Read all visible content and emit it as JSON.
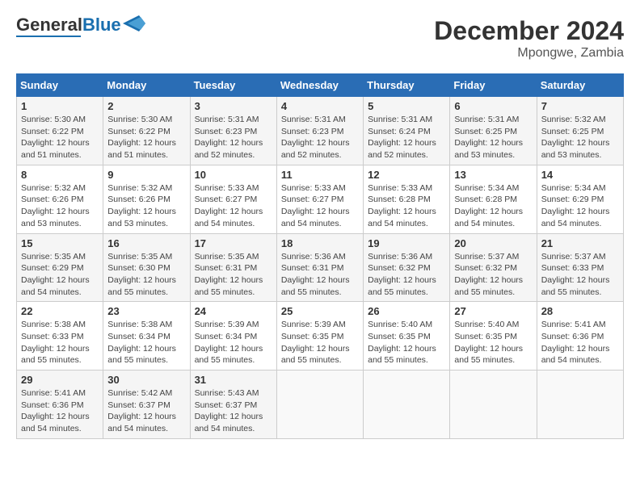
{
  "header": {
    "logo_general": "General",
    "logo_blue": "Blue",
    "title": "December 2024",
    "subtitle": "Mpongwe, Zambia"
  },
  "calendar": {
    "days_of_week": [
      "Sunday",
      "Monday",
      "Tuesday",
      "Wednesday",
      "Thursday",
      "Friday",
      "Saturday"
    ],
    "weeks": [
      [
        {
          "day": "",
          "info": ""
        },
        {
          "day": "2",
          "info": "Sunrise: 5:30 AM\nSunset: 6:22 PM\nDaylight: 12 hours\nand 51 minutes."
        },
        {
          "day": "3",
          "info": "Sunrise: 5:31 AM\nSunset: 6:23 PM\nDaylight: 12 hours\nand 52 minutes."
        },
        {
          "day": "4",
          "info": "Sunrise: 5:31 AM\nSunset: 6:23 PM\nDaylight: 12 hours\nand 52 minutes."
        },
        {
          "day": "5",
          "info": "Sunrise: 5:31 AM\nSunset: 6:24 PM\nDaylight: 12 hours\nand 52 minutes."
        },
        {
          "day": "6",
          "info": "Sunrise: 5:31 AM\nSunset: 6:25 PM\nDaylight: 12 hours\nand 53 minutes."
        },
        {
          "day": "7",
          "info": "Sunrise: 5:32 AM\nSunset: 6:25 PM\nDaylight: 12 hours\nand 53 minutes."
        }
      ],
      [
        {
          "day": "1",
          "info": "Sunrise: 5:30 AM\nSunset: 6:22 PM\nDaylight: 12 hours\nand 51 minutes."
        },
        {
          "day": "",
          "info": ""
        },
        {
          "day": "",
          "info": ""
        },
        {
          "day": "",
          "info": ""
        },
        {
          "day": "",
          "info": ""
        },
        {
          "day": "",
          "info": ""
        },
        {
          "day": "",
          "info": ""
        }
      ],
      [
        {
          "day": "8",
          "info": "Sunrise: 5:32 AM\nSunset: 6:26 PM\nDaylight: 12 hours\nand 53 minutes."
        },
        {
          "day": "9",
          "info": "Sunrise: 5:32 AM\nSunset: 6:26 PM\nDaylight: 12 hours\nand 53 minutes."
        },
        {
          "day": "10",
          "info": "Sunrise: 5:33 AM\nSunset: 6:27 PM\nDaylight: 12 hours\nand 54 minutes."
        },
        {
          "day": "11",
          "info": "Sunrise: 5:33 AM\nSunset: 6:27 PM\nDaylight: 12 hours\nand 54 minutes."
        },
        {
          "day": "12",
          "info": "Sunrise: 5:33 AM\nSunset: 6:28 PM\nDaylight: 12 hours\nand 54 minutes."
        },
        {
          "day": "13",
          "info": "Sunrise: 5:34 AM\nSunset: 6:28 PM\nDaylight: 12 hours\nand 54 minutes."
        },
        {
          "day": "14",
          "info": "Sunrise: 5:34 AM\nSunset: 6:29 PM\nDaylight: 12 hours\nand 54 minutes."
        }
      ],
      [
        {
          "day": "15",
          "info": "Sunrise: 5:35 AM\nSunset: 6:29 PM\nDaylight: 12 hours\nand 54 minutes."
        },
        {
          "day": "16",
          "info": "Sunrise: 5:35 AM\nSunset: 6:30 PM\nDaylight: 12 hours\nand 55 minutes."
        },
        {
          "day": "17",
          "info": "Sunrise: 5:35 AM\nSunset: 6:31 PM\nDaylight: 12 hours\nand 55 minutes."
        },
        {
          "day": "18",
          "info": "Sunrise: 5:36 AM\nSunset: 6:31 PM\nDaylight: 12 hours\nand 55 minutes."
        },
        {
          "day": "19",
          "info": "Sunrise: 5:36 AM\nSunset: 6:32 PM\nDaylight: 12 hours\nand 55 minutes."
        },
        {
          "day": "20",
          "info": "Sunrise: 5:37 AM\nSunset: 6:32 PM\nDaylight: 12 hours\nand 55 minutes."
        },
        {
          "day": "21",
          "info": "Sunrise: 5:37 AM\nSunset: 6:33 PM\nDaylight: 12 hours\nand 55 minutes."
        }
      ],
      [
        {
          "day": "22",
          "info": "Sunrise: 5:38 AM\nSunset: 6:33 PM\nDaylight: 12 hours\nand 55 minutes."
        },
        {
          "day": "23",
          "info": "Sunrise: 5:38 AM\nSunset: 6:34 PM\nDaylight: 12 hours\nand 55 minutes."
        },
        {
          "day": "24",
          "info": "Sunrise: 5:39 AM\nSunset: 6:34 PM\nDaylight: 12 hours\nand 55 minutes."
        },
        {
          "day": "25",
          "info": "Sunrise: 5:39 AM\nSunset: 6:35 PM\nDaylight: 12 hours\nand 55 minutes."
        },
        {
          "day": "26",
          "info": "Sunrise: 5:40 AM\nSunset: 6:35 PM\nDaylight: 12 hours\nand 55 minutes."
        },
        {
          "day": "27",
          "info": "Sunrise: 5:40 AM\nSunset: 6:35 PM\nDaylight: 12 hours\nand 55 minutes."
        },
        {
          "day": "28",
          "info": "Sunrise: 5:41 AM\nSunset: 6:36 PM\nDaylight: 12 hours\nand 54 minutes."
        }
      ],
      [
        {
          "day": "29",
          "info": "Sunrise: 5:41 AM\nSunset: 6:36 PM\nDaylight: 12 hours\nand 54 minutes."
        },
        {
          "day": "30",
          "info": "Sunrise: 5:42 AM\nSunset: 6:37 PM\nDaylight: 12 hours\nand 54 minutes."
        },
        {
          "day": "31",
          "info": "Sunrise: 5:43 AM\nSunset: 6:37 PM\nDaylight: 12 hours\nand 54 minutes."
        },
        {
          "day": "",
          "info": ""
        },
        {
          "day": "",
          "info": ""
        },
        {
          "day": "",
          "info": ""
        },
        {
          "day": "",
          "info": ""
        }
      ]
    ]
  }
}
